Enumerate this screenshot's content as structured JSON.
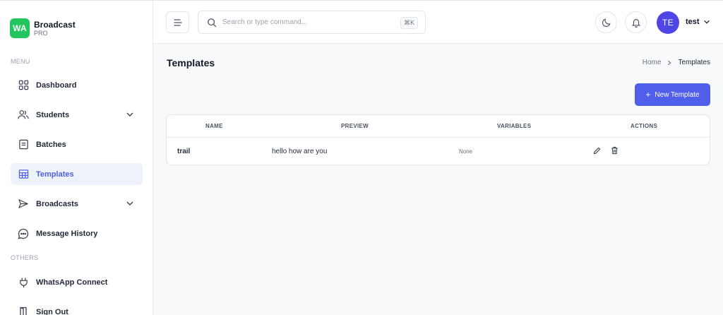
{
  "brand": {
    "logo_text": "WA",
    "name": "Broadcast",
    "sub": "PRO",
    "color": "#22c55e"
  },
  "sidebar": {
    "menu_label": "MENU",
    "others_label": "OTHERS",
    "items": [
      {
        "label": "Dashboard",
        "icon": "grid-icon"
      },
      {
        "label": "Students",
        "icon": "users-icon",
        "expandable": true
      },
      {
        "label": "Batches",
        "icon": "document-icon"
      },
      {
        "label": "Templates",
        "icon": "table-icon",
        "active": true
      },
      {
        "label": "Broadcasts",
        "icon": "send-icon",
        "expandable": true
      },
      {
        "label": "Message History",
        "icon": "chat-bubble-icon"
      }
    ],
    "other_items": [
      {
        "label": "WhatsApp Connect",
        "icon": "plug-icon"
      },
      {
        "label": "Sign Out",
        "icon": "door-icon"
      }
    ]
  },
  "topbar": {
    "search_placeholder": "Search or type command...",
    "shortcut": "⌘K",
    "avatar_initials": "TE",
    "username": "test",
    "accent": "#4f46e5"
  },
  "page": {
    "title": "Templates",
    "breadcrumb": {
      "home": "Home",
      "current": "Templates"
    },
    "new_button": "New Template",
    "new_button_plus": "+",
    "accent": "#4f5fea"
  },
  "table": {
    "headers": [
      "NAME",
      "PREVIEW",
      "VARIABLES",
      "ACTIONS"
    ],
    "rows": [
      {
        "name": "trail",
        "preview": "hello how are you",
        "variables": "None"
      }
    ]
  }
}
